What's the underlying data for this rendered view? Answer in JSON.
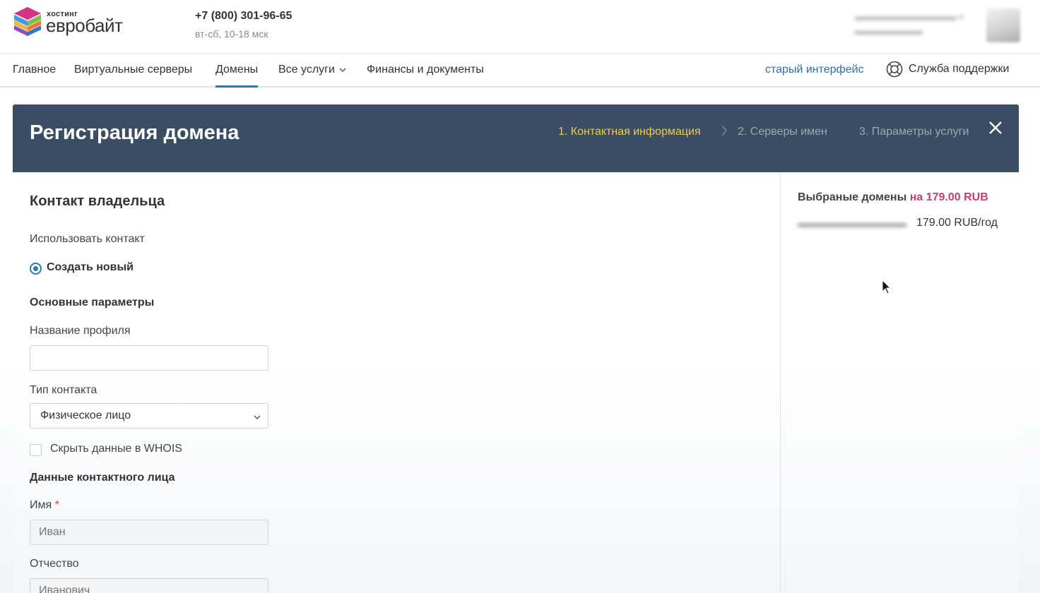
{
  "header": {
    "logo_small": "хостинг",
    "logo_big": "евробайт",
    "phone": "+7 (800) 301-96-65",
    "hours": "вт-сб, 10-18 мск"
  },
  "nav": {
    "items": [
      {
        "label": "Главное"
      },
      {
        "label": "Виртуальные серверы"
      },
      {
        "label": "Домены"
      },
      {
        "label": "Все услуги"
      },
      {
        "label": "Финансы и документы"
      }
    ],
    "old_interface": "старый интерфейс",
    "support": "Служба поддержки"
  },
  "modal": {
    "title": "Регистрация домена",
    "steps": [
      {
        "label": "1. Контактная информация"
      },
      {
        "label": "2. Серверы имен"
      },
      {
        "label": "3. Параметры услуги"
      }
    ],
    "form": {
      "section_title": "Контакт владельца",
      "use_contact_label": "Использовать контакт",
      "radio_label": "Создать новый",
      "basic_params": "Основные параметры",
      "profile_name_label": "Название профиля",
      "profile_name_value": "",
      "contact_type_label": "Тип контакта",
      "contact_type_value": "Физическое лицо",
      "hide_whois_label": "Скрыть данные в WHOIS",
      "contact_person_title": "Данные контактного лица",
      "first_name_label": "Имя",
      "required_mark": "*",
      "first_name_placeholder": "Иван",
      "patronymic_label": "Отчество",
      "patronymic_placeholder": "Иванович"
    },
    "summary": {
      "title": "Выбраные домены",
      "price_prefix": "на 179.00 RUB",
      "domain_price": "179.00 RUB/год"
    }
  },
  "colors": {
    "header_bg": "#3a4d63",
    "active_step": "#f2c94c",
    "accent": "#2b7bb3",
    "price": "#c2426f"
  }
}
